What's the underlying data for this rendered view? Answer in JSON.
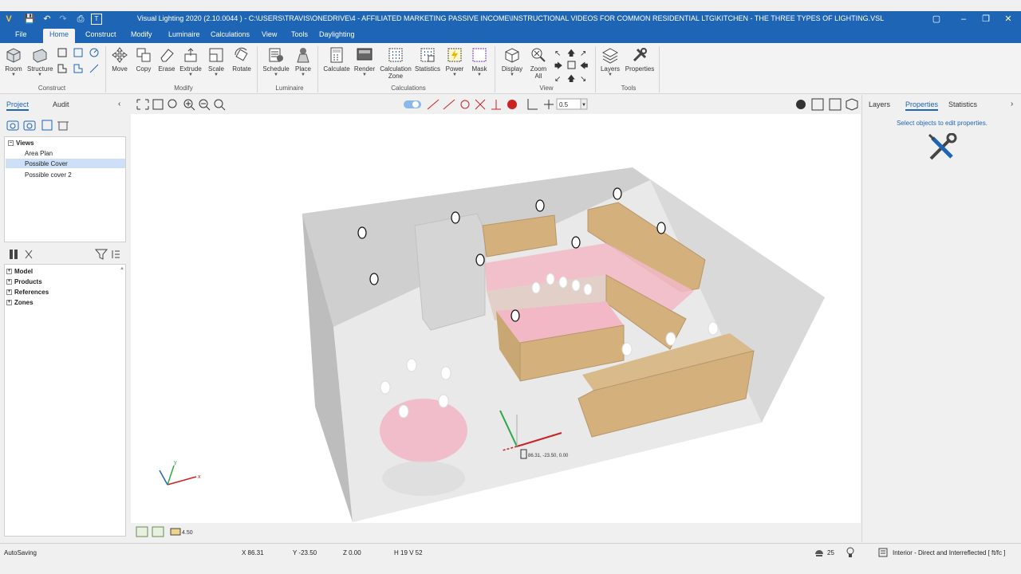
{
  "window": {
    "title": "Visual Lighting 2020 (2.10.0044 ) - C:\\USERS\\TRAVIS\\ONEDRIVE\\4 - AFFILIATED MARKETING PASSIVE INCOME\\INSTRUCTIONAL VIDEOS FOR COMMON RESIDENTIAL LTG\\KITCHEN - THE THREE TYPES OF LIGHTING.VSL"
  },
  "menu": {
    "file": "File",
    "home": "Home",
    "construct": "Construct",
    "modify": "Modify",
    "luminaire": "Luminaire",
    "calculations": "Calculations",
    "view": "View",
    "tools": "Tools",
    "daylighting": "Daylighting"
  },
  "ribbon": {
    "groups": {
      "construct": "Construct",
      "modify": "Modify",
      "luminaire": "Luminaire",
      "calculations": "Calculations",
      "view": "View",
      "tools": "Tools"
    },
    "buttons": {
      "room": "Room",
      "structure": "Structure",
      "move": "Move",
      "copy": "Copy",
      "erase": "Erase",
      "extrude": "Extrude",
      "scale": "Scale",
      "rotate": "Rotate",
      "schedule": "Schedule",
      "place": "Place",
      "calculate": "Calculate",
      "render": "Render",
      "calc_zone_line1": "Calculation",
      "calc_zone_line2": "Zone",
      "statistics": "Statistics",
      "power": "Power",
      "mask": "Mask",
      "display": "Display",
      "zoom_line1": "Zoom",
      "zoom_line2": "All",
      "layers": "Layers",
      "properties": "Properties"
    }
  },
  "left_panel": {
    "tabs": {
      "project": "Project",
      "audit": "Audit"
    },
    "views_tree": {
      "root": "Views",
      "items": [
        "Area Plan",
        "Possible Cover",
        "Possible cover 2"
      ],
      "selected_index": 1
    },
    "model_tree": [
      "Model",
      "Products",
      "References",
      "Zones"
    ]
  },
  "viewport": {
    "toolbar_value": "0.5",
    "cursor_label": "86.31, -23.50, 0.00",
    "axis": {
      "x": "x",
      "y": "y"
    },
    "bottom_value": "4.50"
  },
  "right_panel": {
    "tabs": {
      "layers": "Layers",
      "properties": "Properties",
      "statistics": "Statistics"
    },
    "hint": "Select objects to edit properties."
  },
  "status": {
    "autosave": "AutoSaving",
    "x": "X  86.31",
    "y": "Y  -23.50",
    "z": "Z  0.00",
    "hv": "H 19  V 52",
    "count": "25",
    "mode": "Interior - Direct and Interreflected [ ft/fc ]"
  },
  "colors": {
    "accent": "#1e65b5",
    "cabinet": "#d4b07d",
    "highlight": "#f2b8c6"
  }
}
